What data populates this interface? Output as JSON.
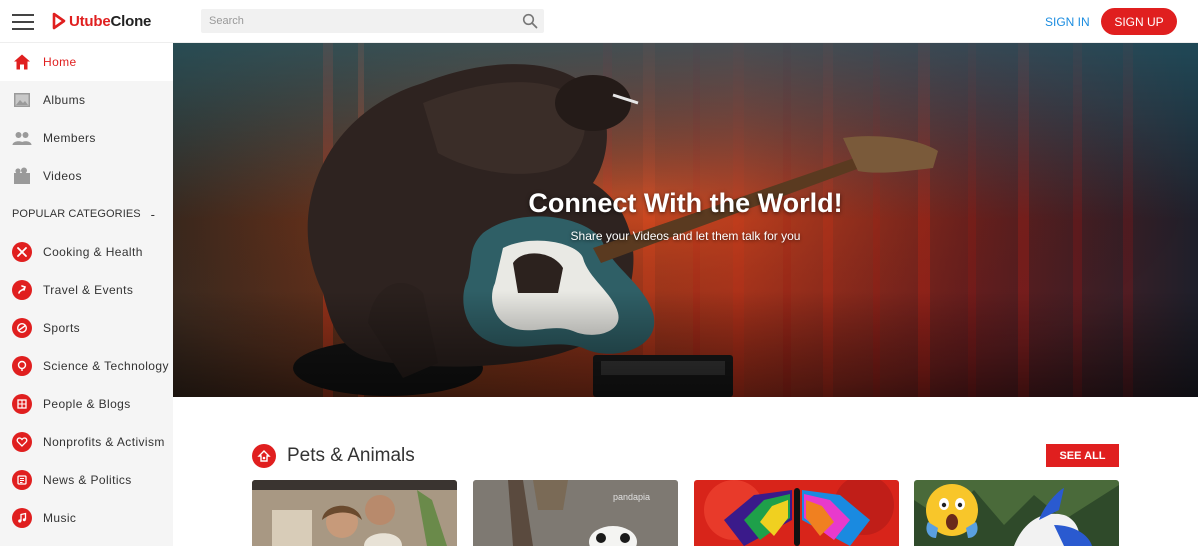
{
  "app": {
    "logo_prefix": "Utube",
    "logo_suffix": "Clone"
  },
  "search": {
    "placeholder": "Search"
  },
  "header": {
    "signin_label": "SIGN IN",
    "signup_label": "SIGN UP"
  },
  "sidebar": {
    "items": [
      {
        "label": "Home",
        "icon": "home-icon"
      },
      {
        "label": "Albums",
        "icon": "image-icon"
      },
      {
        "label": "Members",
        "icon": "people-icon"
      },
      {
        "label": "Videos",
        "icon": "video-icon"
      }
    ],
    "categories_heading": "POPULAR CATEGORIES",
    "categories_toggle": "-",
    "categories": [
      {
        "label": "Cooking & Health",
        "icon": "cutlery-icon"
      },
      {
        "label": "Travel & Events",
        "icon": "travel-icon"
      },
      {
        "label": "Sports",
        "icon": "sports-icon"
      },
      {
        "label": "Science & Technology",
        "icon": "science-icon"
      },
      {
        "label": "People & Blogs",
        "icon": "blog-icon"
      },
      {
        "label": "Nonprofits & Activism",
        "icon": "heart-icon"
      },
      {
        "label": "News & Politics",
        "icon": "news-icon"
      },
      {
        "label": "Music",
        "icon": "music-icon"
      }
    ]
  },
  "hero": {
    "title": "Connect With the World!",
    "subtitle": "Share your Videos and let them talk for you"
  },
  "section": {
    "title": "Pets & Animals",
    "see_all_label": "SEE ALL",
    "thumb_watermark": "pandapia"
  },
  "colors": {
    "accent": "#e01f1f",
    "link": "#1c8de0",
    "sidebar_bg": "#f5f5f5"
  }
}
